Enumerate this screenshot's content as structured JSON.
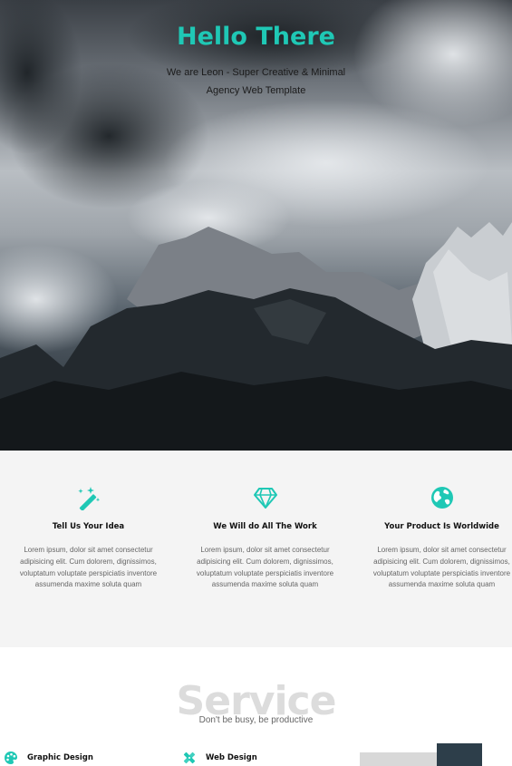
{
  "hero": {
    "title": "Hello There",
    "subtitle": "We are Leon - Super Creative & Minimal Agency Web Template"
  },
  "features": [
    {
      "icon": "magic-wand-icon",
      "title": "Tell Us Your Idea",
      "text": "Lorem ipsum, dolor sit amet consectetur adipisicing elit. Cum dolorem, dignissimos, voluptatum voluptate perspiciatis inventore assumenda maxime soluta quam"
    },
    {
      "icon": "diamond-icon",
      "title": "We Will do All The Work",
      "text": "Lorem ipsum, dolor sit amet consectetur adipisicing elit. Cum dolorem, dignissimos, voluptatum voluptate perspiciatis inventore assumenda maxime soluta quam"
    },
    {
      "icon": "globe-icon",
      "title": "Your Product Is Worldwide",
      "text": "Lorem ipsum, dolor sit amet consectetur adipisicing elit. Cum dolorem, dignissimos, voluptatum voluptate perspiciatis inventore assumenda maxime soluta quam"
    }
  ],
  "service": {
    "heading": "Service",
    "subheading": "Don't be busy, be productive",
    "items": [
      {
        "icon": "palette-icon",
        "label": "Graphic Design"
      },
      {
        "icon": "pencil-ruler-icon",
        "label": "Web Design"
      }
    ]
  },
  "colors": {
    "accent": "#1fc8b5",
    "section_bg": "#f4f4f4",
    "dark_block": "#2d3e4a"
  }
}
